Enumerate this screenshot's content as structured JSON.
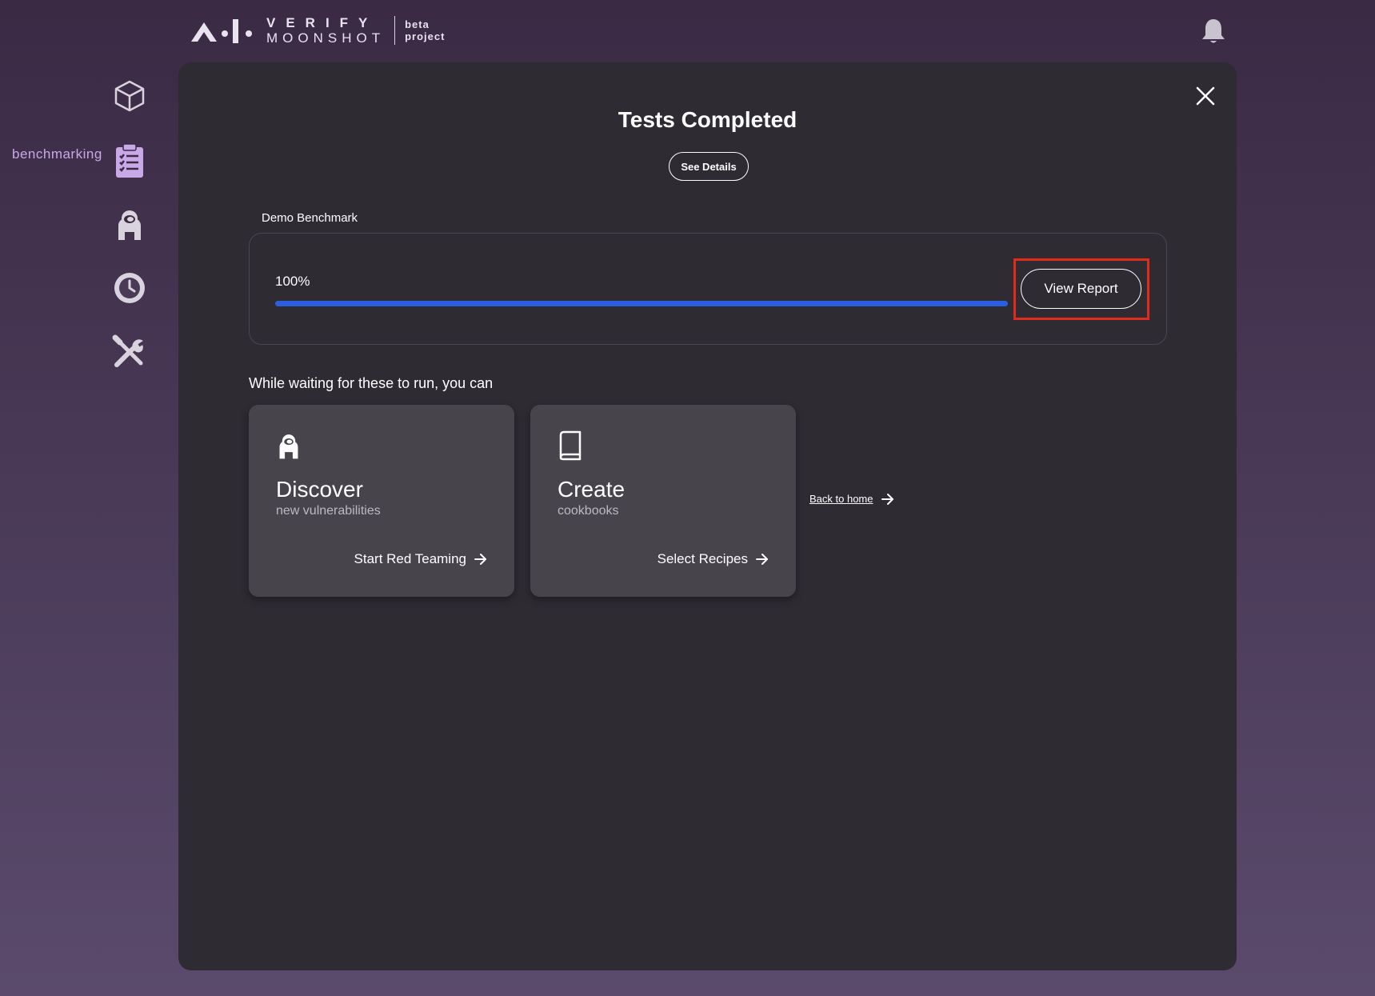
{
  "header": {
    "brand_line1": "VERIFY",
    "brand_line2": "MOONSHOT",
    "brand_beta_1": "beta",
    "brand_beta_2": "project",
    "icon_bell": "bell-icon"
  },
  "sidebar": {
    "active_label": "benchmarking",
    "items": [
      {
        "icon": "cube-icon"
      },
      {
        "icon": "clipboard-checklist-icon",
        "label": "benchmarking",
        "active": true
      },
      {
        "icon": "red-teaming-agent-icon"
      },
      {
        "icon": "history-clock-icon"
      },
      {
        "icon": "tools-icon"
      }
    ]
  },
  "modal": {
    "title": "Tests Completed",
    "see_details": "See Details",
    "benchmark_name": "Demo Benchmark",
    "progress_text": "100%",
    "progress_value": 1.0,
    "view_report": "View Report",
    "waiting_text": "While waiting for these to run, you can",
    "cards": [
      {
        "icon": "red-teaming-agent-icon",
        "title": "Discover",
        "subtitle": "new vulnerabilities",
        "link": "Start Red Teaming"
      },
      {
        "icon": "book-icon",
        "title": "Create",
        "subtitle": "cookbooks",
        "link": "Select Recipes"
      }
    ],
    "back_home": "Back to home"
  },
  "colors": {
    "accent_progress": "#2c5fe0",
    "sidebar_active": "#c9a8e8",
    "highlight_box": "#e02a1a"
  }
}
